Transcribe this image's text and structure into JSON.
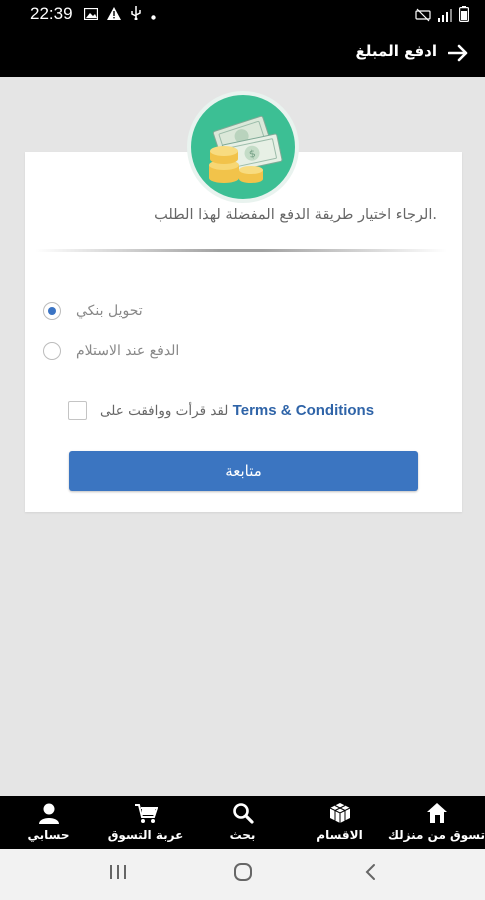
{
  "status_bar": {
    "time": "22:39"
  },
  "app_bar": {
    "title": "ادفع المبلغ"
  },
  "card": {
    "instruction": ".الرجاء اختيار طريقة الدفع المفضلة لهذا الطلب",
    "payment_options": [
      {
        "label": "تحويل بنكي",
        "selected": true
      },
      {
        "label": "الدفع عند الاستلام",
        "selected": false
      }
    ],
    "terms": {
      "prefix": "لقد قرأت ووافقت على",
      "link": "Terms & Conditions",
      "checked": false
    },
    "continue_label": "متابعة"
  },
  "bottom_nav": {
    "items": [
      {
        "label": "حسابي",
        "icon": "person-icon"
      },
      {
        "label": "عربة التسوق",
        "icon": "cart-icon"
      },
      {
        "label": "بحث",
        "icon": "search-icon"
      },
      {
        "label": "الاقسام",
        "icon": "grid-icon"
      },
      {
        "label": "تسوق من منزلك",
        "icon": "home-icon"
      }
    ]
  },
  "colors": {
    "accent": "#3b75c1",
    "badge": "#3cbf94",
    "bars": "#000000",
    "background": "#e5e5e5"
  }
}
